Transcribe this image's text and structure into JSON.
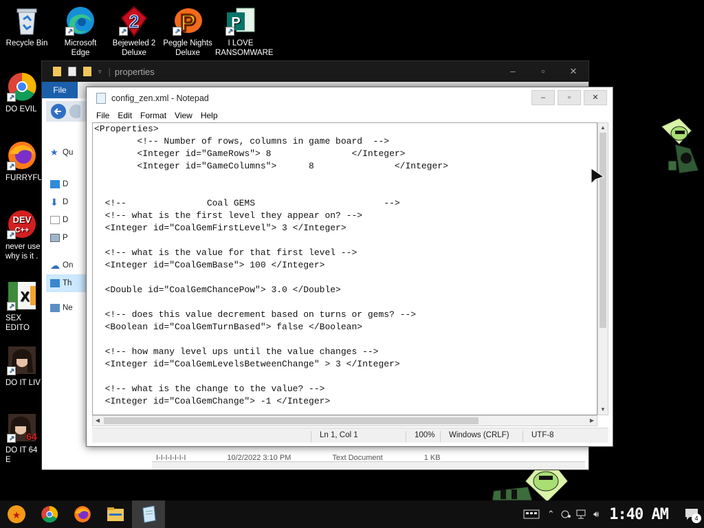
{
  "desktop": {
    "top_icons": [
      {
        "label": "Recycle Bin",
        "icon": "recycle-bin-icon"
      },
      {
        "label": "Microsoft Edge",
        "icon": "edge-icon"
      },
      {
        "label": "Bejeweled 2\nDeluxe",
        "icon": "bejeweled-icon"
      },
      {
        "label": "Peggle Nights\nDeluxe",
        "icon": "peggle-icon"
      },
      {
        "label": "I LOVE\nRANSOMWARE",
        "icon": "publisher-icon"
      }
    ],
    "side_icons": [
      {
        "label": "DO EVIL",
        "icon": "chrome-icon"
      },
      {
        "label": "FURRYFUC",
        "icon": "firefox-icon"
      },
      {
        "label": "never use\nwhy is it .",
        "icon": "devcpp-icon"
      },
      {
        "label": "SEX EDITO",
        "icon": "hxd-icon"
      },
      {
        "label": "DO IT LIV",
        "icon": "portrait-icon"
      },
      {
        "label": "DO IT 64 E",
        "icon": "portrait64-icon"
      }
    ]
  },
  "explorer": {
    "title": "properties",
    "ribbon_file": "File",
    "nav": [
      "Qu",
      "D",
      "D",
      "D",
      "P",
      "On",
      "Th",
      "Ne"
    ],
    "status_items": [
      "I-I-I-I-I-I-I",
      "10/2/2022 3:10 PM",
      "Text Document",
      "1 KB"
    ]
  },
  "notepad": {
    "title": "config_zen.xml - Notepad",
    "menu": [
      "File",
      "Edit",
      "Format",
      "View",
      "Help"
    ],
    "content": "<Properties>\n        <!-- Number of rows, columns in game board  -->\n        <Integer id=\"GameRows\"> 8               </Integer>\n        <Integer id=\"GameColumns\">      8               </Integer>\n\n\n  <!--               Coal GEMS                        -->\n  <!-- what is the first level they appear on? -->\n  <Integer id=\"CoalGemFirstLevel\"> 3 </Integer>\n\n  <!-- what is the value for that first level -->\n  <Integer id=\"CoalGemBase\"> 100 </Integer>\n\n  <Double id=\"CoalGemChancePow\"> 3.0 </Double>\n\n  <!-- does this value decrement based on turns or gems? -->\n  <Boolean id=\"CoalGemTurnBased\"> false </Boolean>\n\n  <!-- how many level ups until the value changes -->\n  <Integer id=\"CoalGemLevelsBetweenChange\" > 3 </Integer>\n\n  <!-- what is the change to the value? -->\n  <Integer id=\"CoalGemChange\"> -1 </Integer>",
    "status": {
      "position": "Ln 1, Col 1",
      "zoom": "100%",
      "line_ending": "Windows (CRLF)",
      "encoding": "UTF-8"
    }
  },
  "taskbar": {
    "apps": [
      "dragonball-icon",
      "chrome-icon",
      "firefox-icon",
      "file-explorer-icon",
      "notepad-icon"
    ],
    "clock": "1:40 AM",
    "notification_count": "4"
  },
  "colors": {
    "accent": "#1b5fab",
    "selection": "#cde8ff",
    "taskbar": "#101010"
  }
}
